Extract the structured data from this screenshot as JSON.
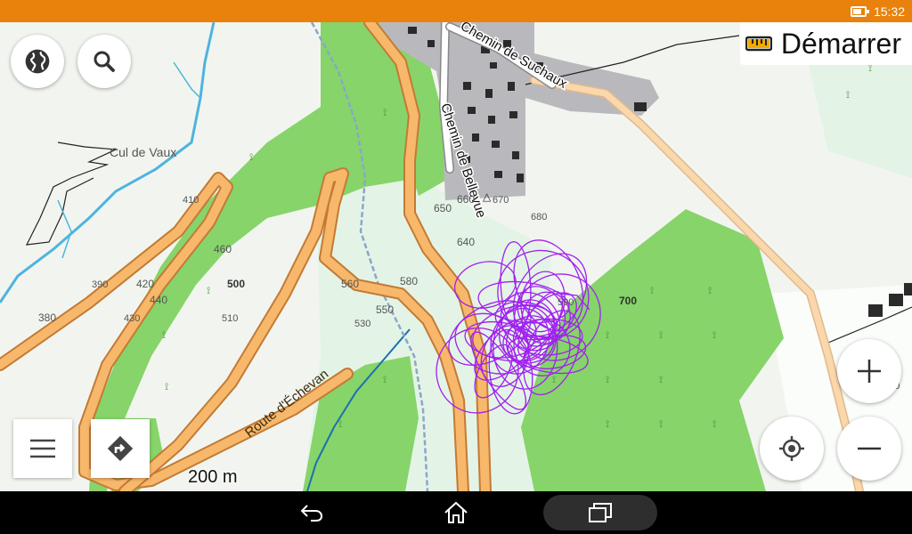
{
  "status_bar": {
    "time": "15:32",
    "battery_level": 0.75,
    "background_color": "#e8820c"
  },
  "toolbar": {
    "start_label": "Démarrer",
    "ruler_icon": "ruler-icon",
    "accent_color": "#f2a900"
  },
  "buttons": {
    "layers": "globe-icon",
    "search": "search-icon",
    "menu": "hamburger-menu-icon",
    "directions": "directions-icon",
    "zoom_in": "plus-icon",
    "zoom_out": "minus-icon",
    "locate": "my-location-icon"
  },
  "map": {
    "place_names": [
      "Cul de Vaux"
    ],
    "street_names": [
      "Chemin de Suchaux",
      "Chemin de Bellevue",
      "Route d'Échevan"
    ],
    "contour_labels": [
      "410",
      "460",
      "500",
      "510",
      "390",
      "420",
      "440",
      "430",
      "380",
      "560",
      "550",
      "530",
      "580",
      "590",
      "640",
      "650",
      "660",
      "670",
      "680",
      "700",
      "700"
    ],
    "peak_label": "670",
    "scale_label": "200 m",
    "track_color": "#a020f0",
    "road_color": "#f7b86b",
    "forest_color": "#86d46a"
  },
  "nav_bar": {
    "back": "back-icon",
    "home": "home-icon",
    "recents": "recents-icon"
  }
}
